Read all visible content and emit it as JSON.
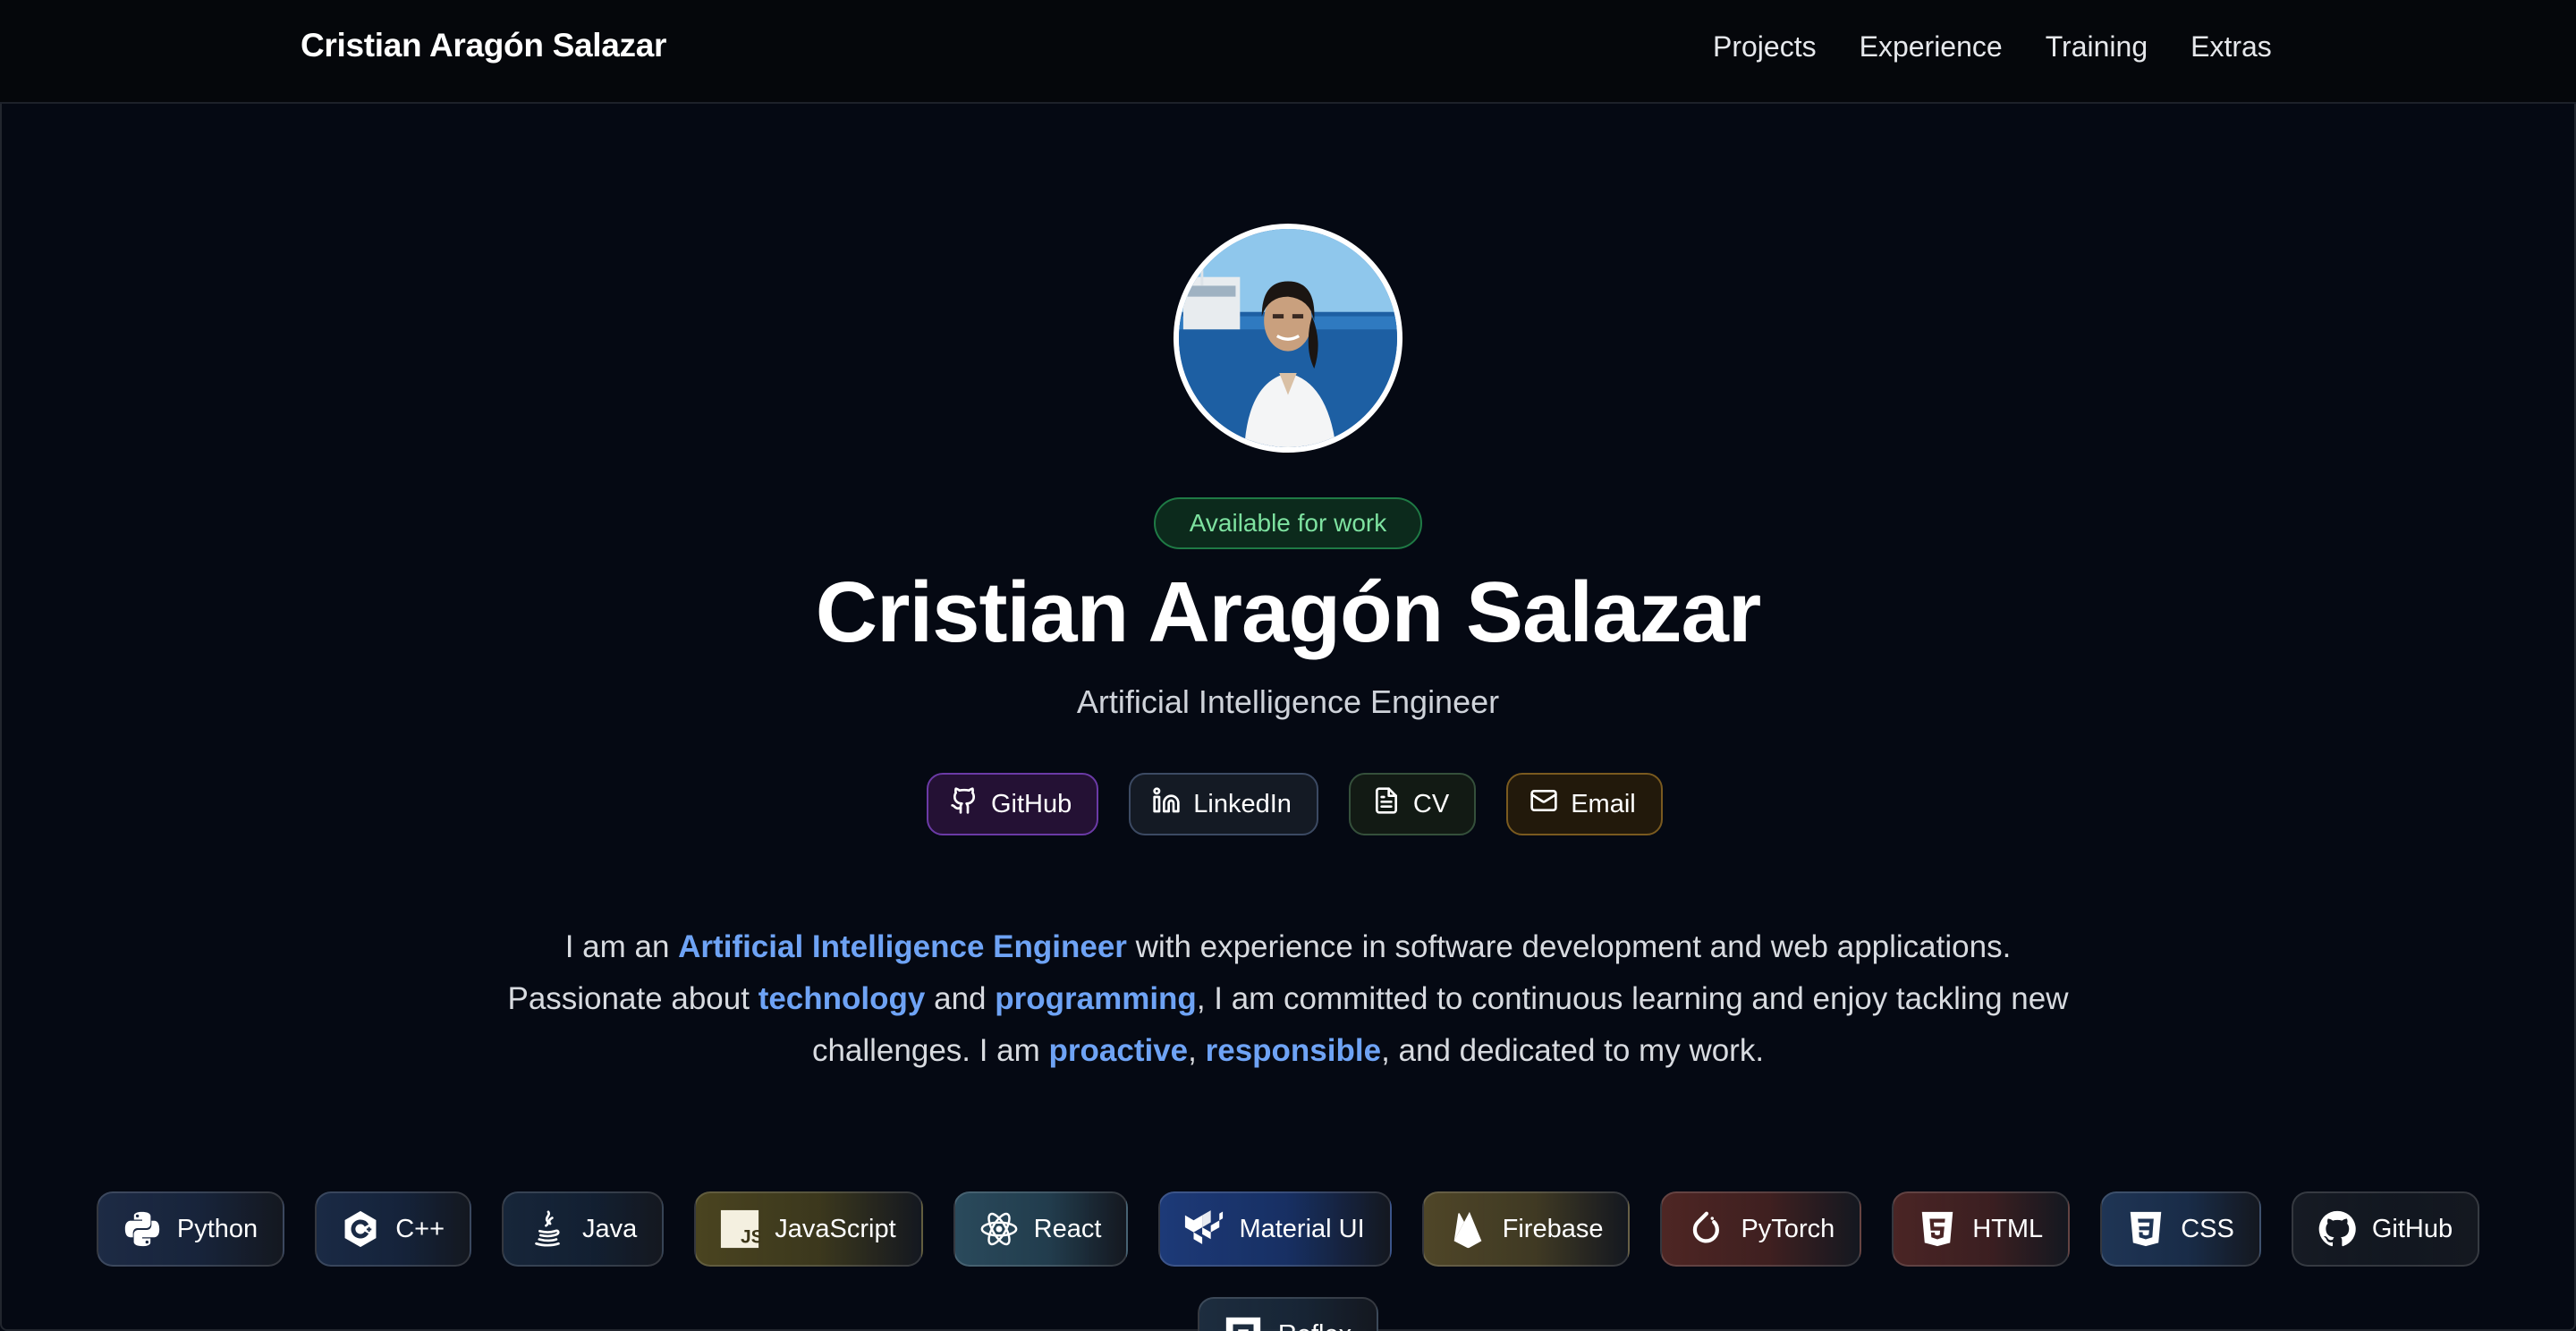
{
  "nav": {
    "brand": "Cristian Aragón Salazar",
    "links": [
      "Projects",
      "Experience",
      "Training",
      "Extras"
    ]
  },
  "hero": {
    "status_badge": "Available for work",
    "name": "Cristian Aragón Salazar",
    "role": "Artificial Intelligence Engineer",
    "links": [
      {
        "label": "GitHub",
        "icon": "github-icon"
      },
      {
        "label": "LinkedIn",
        "icon": "linkedin-icon"
      },
      {
        "label": "CV",
        "icon": "document-icon"
      },
      {
        "label": "Email",
        "icon": "mail-icon"
      }
    ]
  },
  "bio": {
    "s1": "I am an ",
    "h1": "Artificial Intelligence Engineer",
    "s2": " with experience in software development and web applications. Passionate about ",
    "h2": "technology",
    "s3": " and ",
    "h3": "programming",
    "s4": ", I am committed to continuous learning and enjoy tackling new challenges. I am ",
    "h4": "proactive",
    "s5": ", ",
    "h5": "responsible",
    "s6": ", and dedicated to my work.",
    "highlight_color": "#6ea3f5"
  },
  "skills": [
    {
      "label": "Python",
      "icon": "python-icon",
      "bg": "#1d2b45"
    },
    {
      "label": "C++",
      "icon": "cpp-icon",
      "bg": "#1a2a45"
    },
    {
      "label": "Java",
      "icon": "java-icon",
      "bg": "#17263a"
    },
    {
      "label": "JavaScript",
      "icon": "javascript-icon",
      "bg": "#4a4420"
    },
    {
      "label": "React",
      "icon": "react-icon",
      "bg": "#2a4a5c"
    },
    {
      "label": "Material UI",
      "icon": "material-ui-icon",
      "bg": "#1d3a78"
    },
    {
      "label": "Firebase",
      "icon": "firebase-icon",
      "bg": "#4f4628"
    },
    {
      "label": "PyTorch",
      "icon": "pytorch-icon",
      "bg": "#4e2624"
    },
    {
      "label": "HTML",
      "icon": "html-icon",
      "bg": "#4a2525"
    },
    {
      "label": "CSS",
      "icon": "css-icon",
      "bg": "#1f3555"
    },
    {
      "label": "GitHub",
      "icon": "github-icon",
      "bg": "#161b24"
    },
    {
      "label": "Reflex",
      "icon": "reflex-icon",
      "bg": "#1d2d3f"
    }
  ]
}
